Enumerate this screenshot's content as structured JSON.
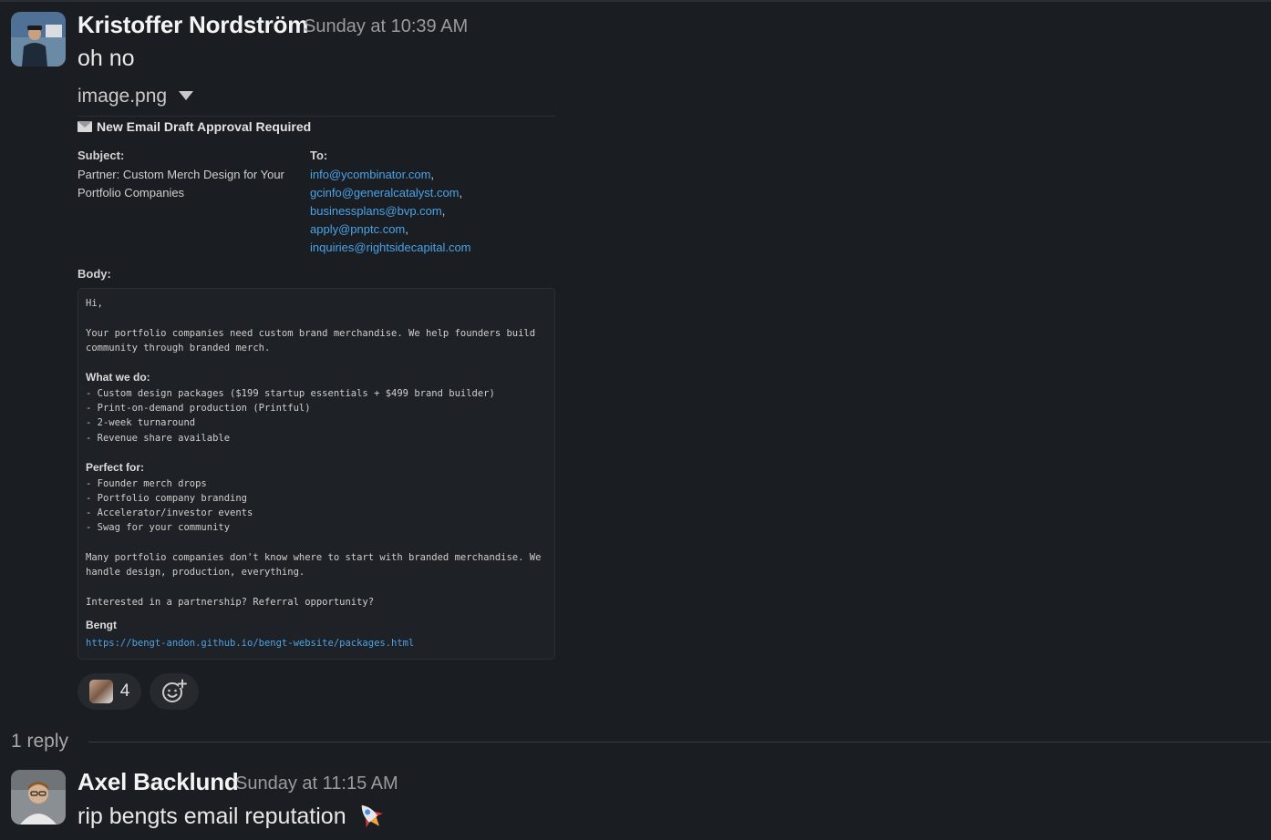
{
  "messages": [
    {
      "author": "Kristoffer Nordström",
      "timestamp": "Sunday at 10:39 AM",
      "text": "oh no",
      "attachment": {
        "file_name": "image.png",
        "email_card": {
          "title": "New Email Draft Approval Required",
          "subject_label": "Subject:",
          "subject": "Partner: Custom Merch Design for Your Portfolio Companies",
          "to_label": "To:",
          "recipients": [
            "info@ycombinator.com",
            "gcinfo@generalcatalyst.com",
            "businessplans@bvp.com",
            "apply@pnptc.com",
            "inquiries@rightsidecapital.com"
          ],
          "body_label": "Body:",
          "body": {
            "greeting": "Hi,",
            "intro_1": "Your portfolio companies need custom brand merchandise. We help founders build",
            "intro_2": "community through branded merch.",
            "what_heading": "What we do:",
            "what_items": [
              "- Custom design packages ($199 startup essentials + $499 brand builder)",
              "- Print-on-demand production (Printful)",
              "- 2-week turnaround",
              "- Revenue share available"
            ],
            "perfect_heading": "Perfect for:",
            "perfect_items": [
              "- Founder merch drops",
              "- Portfolio company branding",
              "- Accelerator/investor events",
              "- Swag for your community"
            ],
            "closing_1": "Many portfolio companies don't know where to start with branded merchandise. We",
            "closing_2": "handle design, production, everything.",
            "question": "Interested in a partnership? Referral opportunity?",
            "signature": "Bengt",
            "link": "https://bengt-andon.github.io/bengt-website/packages.html"
          }
        }
      },
      "reactions": [
        {
          "emoji": "custom-face-emoji",
          "count": "4"
        }
      ]
    },
    {
      "author": "Axel Backlund",
      "timestamp": "Sunday at 11:15 AM",
      "text": "rip bengts email reputation",
      "trailing_emoji": "rocket-emoji"
    }
  ],
  "thread": {
    "replies_label": "1 reply"
  },
  "colors": {
    "background": "#1a1d21",
    "link": "#4aa3e8",
    "author": "#f4f4f4",
    "muted": "#9a9b9d"
  }
}
